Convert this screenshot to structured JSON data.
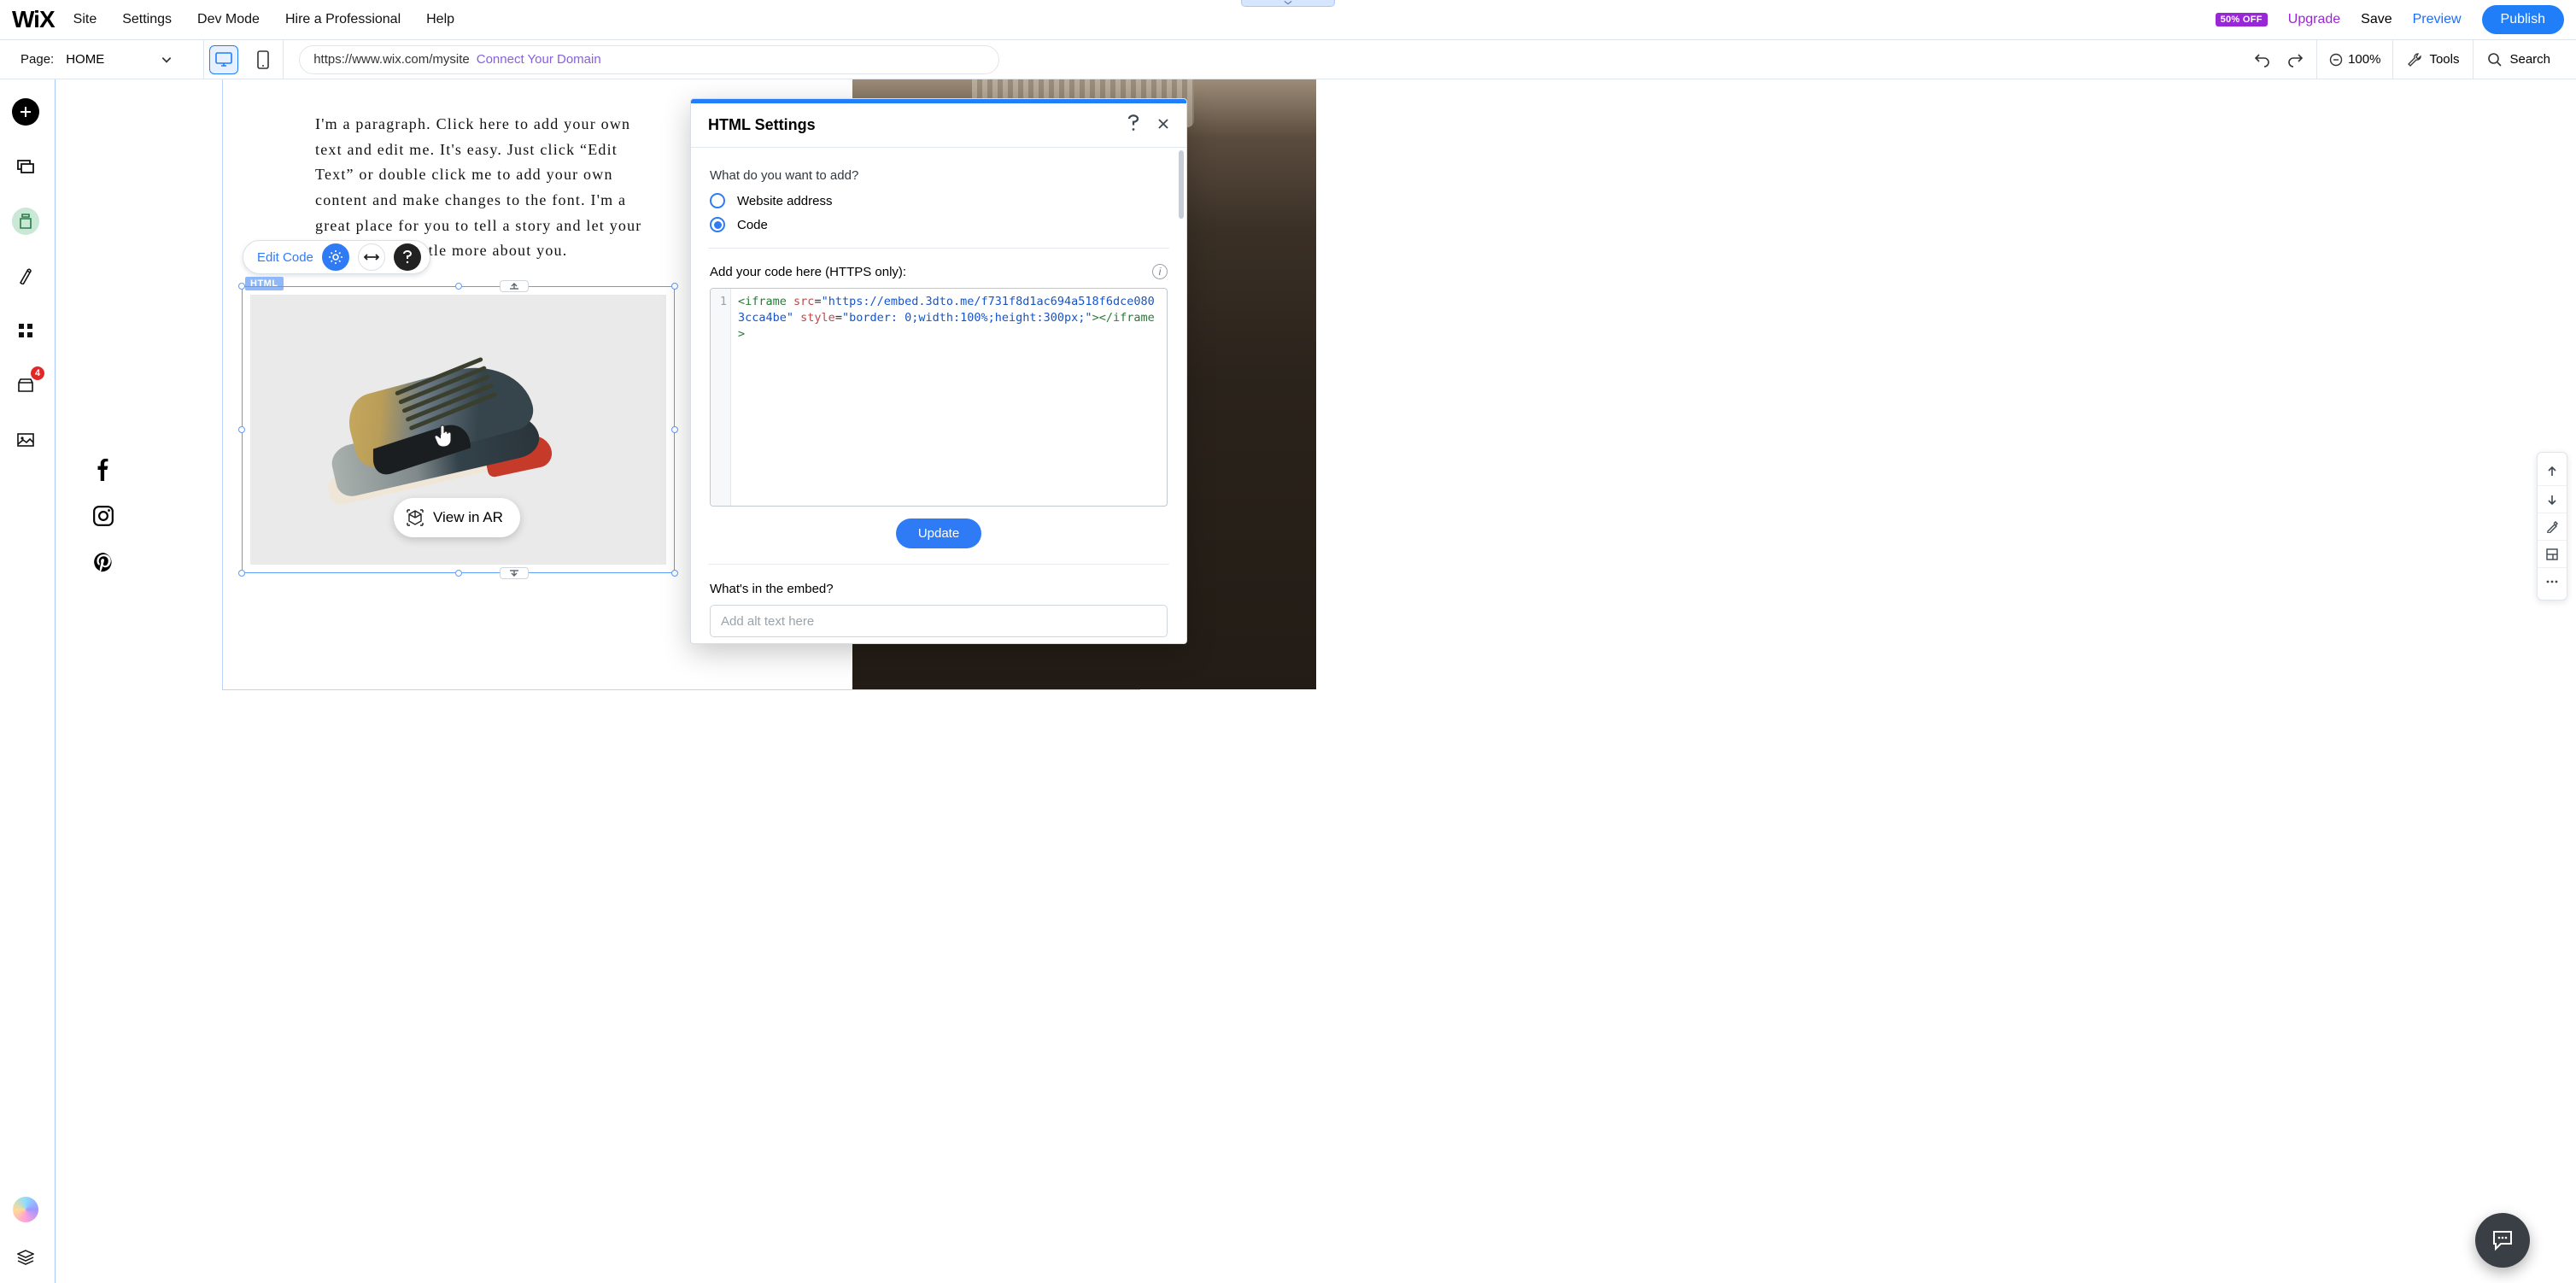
{
  "topbar": {
    "logo": "WiX",
    "menu": [
      "Site",
      "Settings",
      "Dev Mode",
      "Hire a Professional",
      "Help"
    ],
    "badge": "50% OFF",
    "upgrade": "Upgrade",
    "save": "Save",
    "preview": "Preview",
    "publish": "Publish"
  },
  "secondbar": {
    "page_label": "Page:",
    "page_name": "HOME",
    "url": "https://www.wix.com/mysite",
    "connect": "Connect Your Domain",
    "zoom": "100%",
    "tools": "Tools",
    "search": "Search"
  },
  "leftrail": {
    "badge_count": "4"
  },
  "canvas": {
    "paragraph": "I'm a paragraph. Click here to add your own text and edit me. It's easy. Just click “Edit Text” or double click me to add your own content and make changes to the font. I'm a great place for you to tell a story and let your users know a little more about you.",
    "edit_code": "Edit Code",
    "html_badge": "HTML",
    "view_in_ar": "View in AR"
  },
  "panel": {
    "title": "HTML Settings",
    "q1": "What do you want to add?",
    "opt_website": "Website address",
    "opt_code": "Code",
    "code_label": "Add your code here (HTTPS only):",
    "gutter_1": "1",
    "code_line": "<iframe src=\"https://embed.3dto.me/f731f8d1ac694a518f6dce0803cca4be\" style=\"border: 0;width:100%;height:300px;\"></iframe>",
    "code_tokens": {
      "open": "<iframe",
      "src_attr": "src",
      "src_val": "\"https://embed.3dto.me/f731f8d1ac694a518f6dce0803cca4be\"",
      "style_attr": "style",
      "style_val": "\"border: 0;width:100%;height:300px;\"",
      "close": "></iframe>"
    },
    "update": "Update",
    "q2": "What's in the embed?",
    "alt_placeholder": "Add alt text here"
  }
}
